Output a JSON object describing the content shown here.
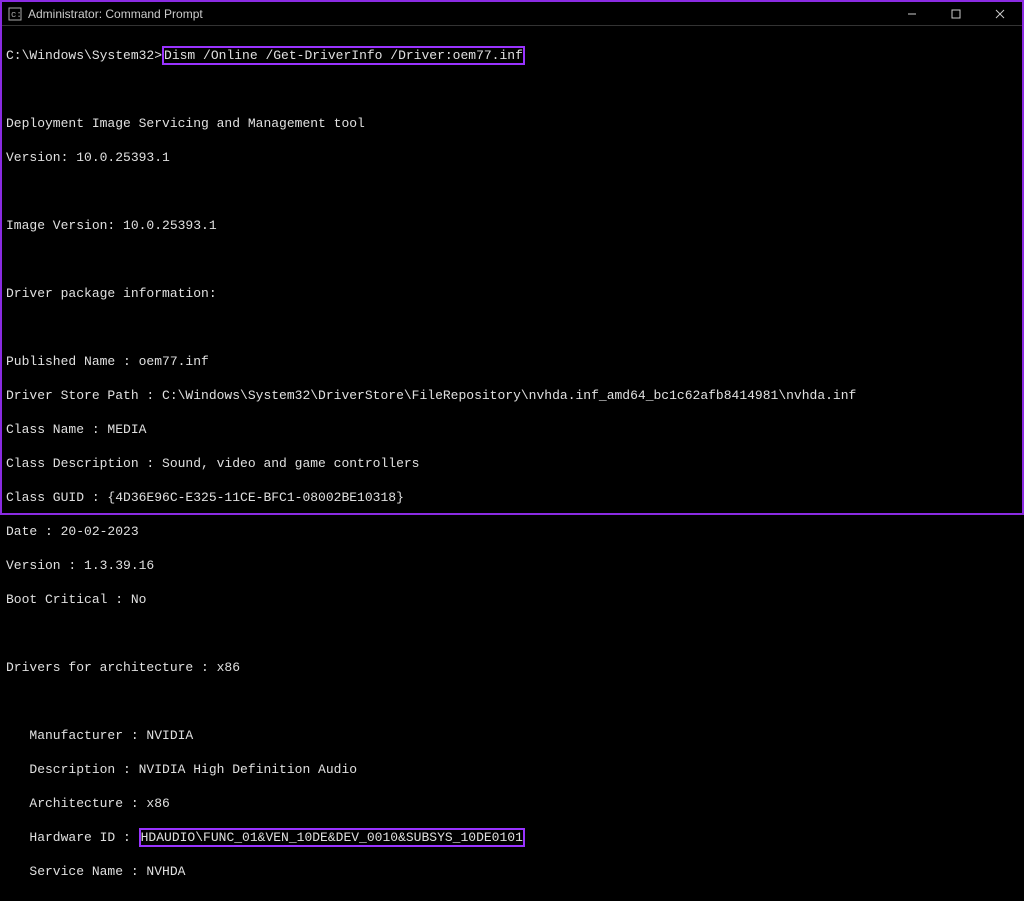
{
  "titlebar": {
    "title": "Administrator: Command Prompt"
  },
  "terminal": {
    "prompt": "C:\\Windows\\System32>",
    "command": "Dism /Online /Get-DriverInfo /Driver:oem77.inf",
    "lines": {
      "tool_name": "Deployment Image Servicing and Management tool",
      "tool_version": "Version: 10.0.25393.1",
      "image_version": "Image Version: 10.0.25393.1",
      "section_header": "Driver package information:",
      "published_name": "Published Name : oem77.inf",
      "driver_store_path": "Driver Store Path : C:\\Windows\\System32\\DriverStore\\FileRepository\\nvhda.inf_amd64_bc1c62afb8414981\\nvhda.inf",
      "class_name": "Class Name : MEDIA",
      "class_description": "Class Description : Sound, video and game controllers",
      "class_guid": "Class GUID : {4D36E96C-E325-11CE-BFC1-08002BE10318}",
      "date": "Date : 20-02-2023",
      "version": "Version : 1.3.39.16",
      "boot_critical": "Boot Critical : No",
      "arch_header": "Drivers for architecture : x86",
      "manufacturer": "   Manufacturer : NVIDIA",
      "description": "   Description : NVIDIA High Definition Audio",
      "architecture": "   Architecture : x86",
      "hardware_id_label": "   Hardware ID : ",
      "hardware_id_value": "HDAUDIO\\FUNC_01&VEN_10DE&DEV_0010&SUBSYS_10DE0101",
      "service_name": "   Service Name : NVHDA"
    }
  }
}
